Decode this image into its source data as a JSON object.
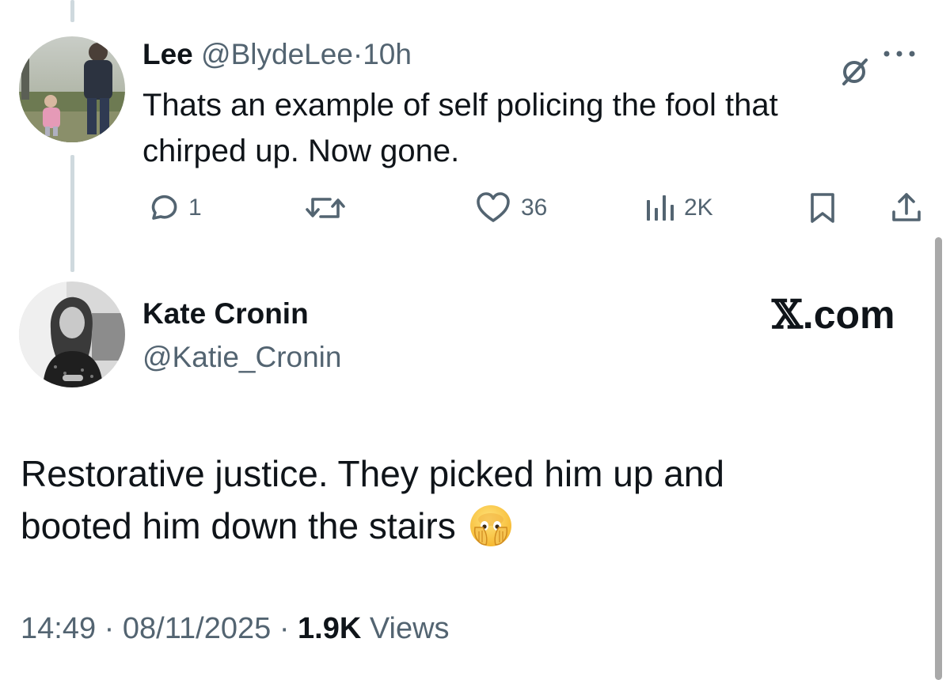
{
  "reply": {
    "author_name": "Lee",
    "author_handle": "@BlydeLee",
    "separator": "·",
    "time_ago": "10h",
    "text_lines": [
      "Thats an example of self policing the fool that",
      "chirped up. Now gone."
    ],
    "actions": {
      "reply_count": "1",
      "retweet_count": "",
      "like_count": "36",
      "view_count": "2K"
    }
  },
  "tweet": {
    "author_name": "Kate Cronin",
    "author_handle": "@Katie_Cronin",
    "watermark_x": "𝕏",
    "watermark_domain": ".com",
    "text_lines": [
      "Restorative justice. They picked him up and",
      "booted him down the stairs"
    ],
    "emoji": "face-with-open-eyes-and-hand-over-mouth",
    "time": "14:49",
    "separator": "·",
    "date": "08/11/2025",
    "views_count": "1.9K",
    "views_label": "Views"
  },
  "colors": {
    "text_primary": "#0f1419",
    "text_muted": "#536471",
    "thread_line": "#cfd9de"
  }
}
